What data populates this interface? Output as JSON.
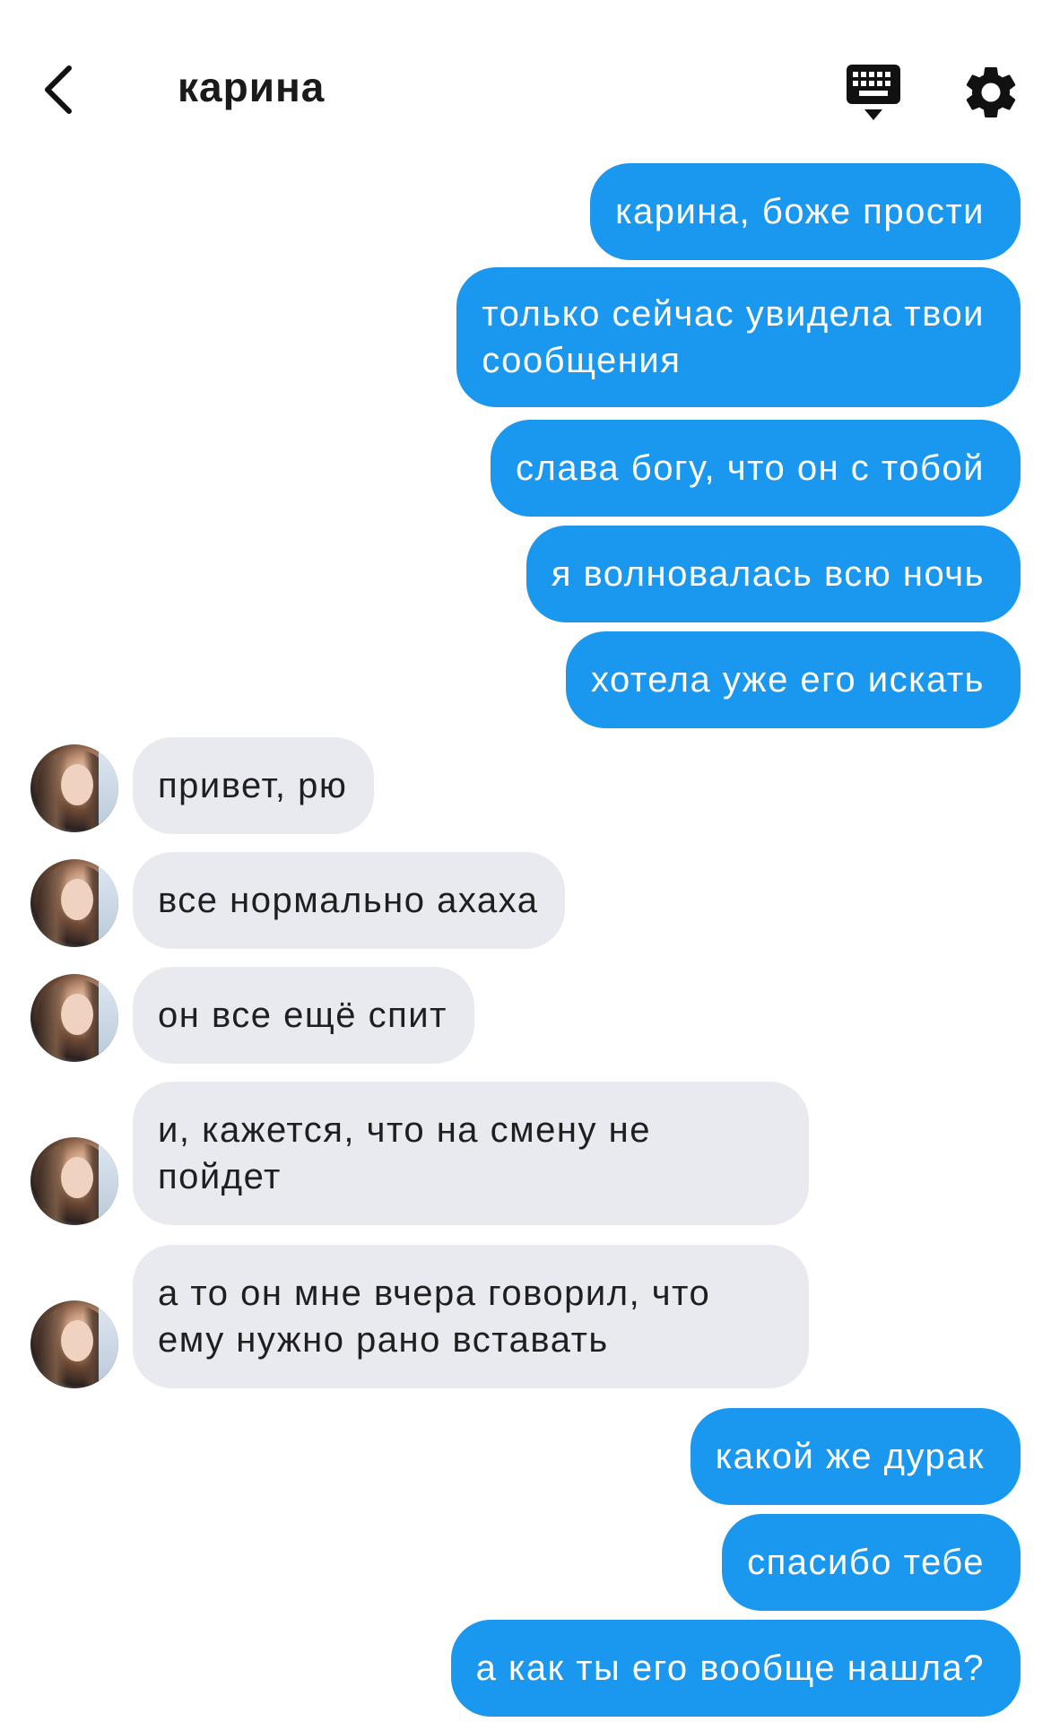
{
  "header": {
    "title": "карина",
    "back_icon": "chevron-left-icon",
    "keyboard_icon": "keyboard-icon",
    "settings_icon": "gear-icon"
  },
  "colors": {
    "outgoing_bubble": "#1a97ef",
    "incoming_bubble": "#e8eaf0",
    "background": "#ffffff"
  },
  "messages": [
    {
      "side": "out",
      "text": "карина, боже прости"
    },
    {
      "side": "out",
      "text": "только сейчас увидела твои\nсообщения"
    },
    {
      "side": "out",
      "text": "слава богу, что он с тобой"
    },
    {
      "side": "out",
      "text": "я волновалась всю ночь"
    },
    {
      "side": "out",
      "text": "хотела уже его искать"
    },
    {
      "side": "in",
      "text": "привет, рю"
    },
    {
      "side": "in",
      "text": "все нормально ахаха"
    },
    {
      "side": "in",
      "text": "он все ещё спит"
    },
    {
      "side": "in",
      "text": "и, кажется, что на смену не\nпойдет"
    },
    {
      "side": "in",
      "text": "а то он мне вчера говорил, что\nему нужно рано вставать"
    },
    {
      "side": "out",
      "text": "какой же дурак"
    },
    {
      "side": "out",
      "text": "спасибо тебе"
    },
    {
      "side": "out",
      "text": "а как ты его вообще нашла?"
    }
  ]
}
